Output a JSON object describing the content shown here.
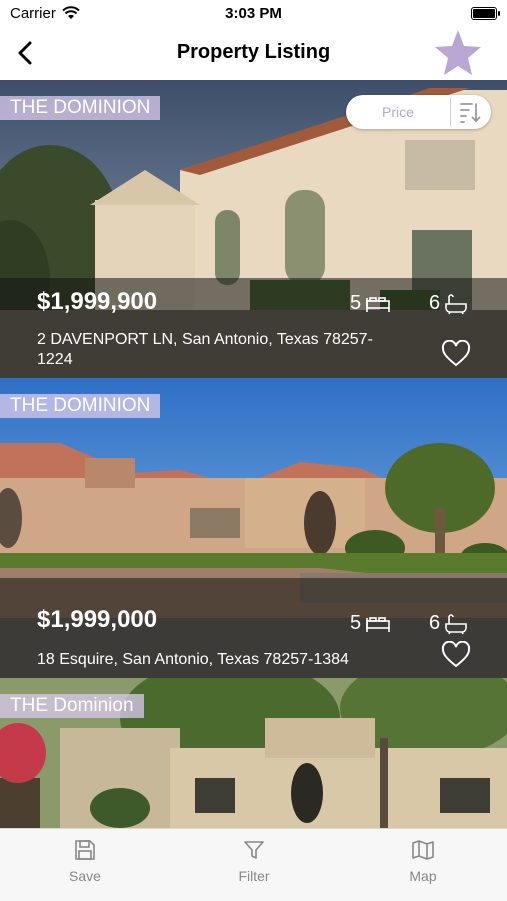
{
  "status_bar": {
    "carrier": "Carrier",
    "time": "3:03 PM"
  },
  "nav": {
    "title": "Property Listing",
    "back_icon": "chevron-left-icon",
    "favorite_icon": "star-icon",
    "favorite_color": "#b9a6d3"
  },
  "sort": {
    "label": "Price",
    "icon": "sort-descending-icon"
  },
  "listings": [
    {
      "tag": "THE DOMINION",
      "price": "$1,999,900",
      "address": "2 DAVENPORT LN, San Antonio, Texas 78257-1224",
      "beds": "5",
      "baths": "6"
    },
    {
      "tag": "THE DOMINION",
      "price": "$1,999,000",
      "address": "18 Esquire, San Antonio, Texas 78257-1384",
      "beds": "5",
      "baths": "6"
    },
    {
      "tag": "THE Dominion"
    }
  ],
  "tabs": [
    {
      "label": "Save",
      "icon": "save-icon"
    },
    {
      "label": "Filter",
      "icon": "filter-icon"
    },
    {
      "label": "Map",
      "icon": "map-icon"
    }
  ],
  "colors": {
    "accent": "#b9a6d3",
    "tag_bg": "#d7c8eb"
  }
}
